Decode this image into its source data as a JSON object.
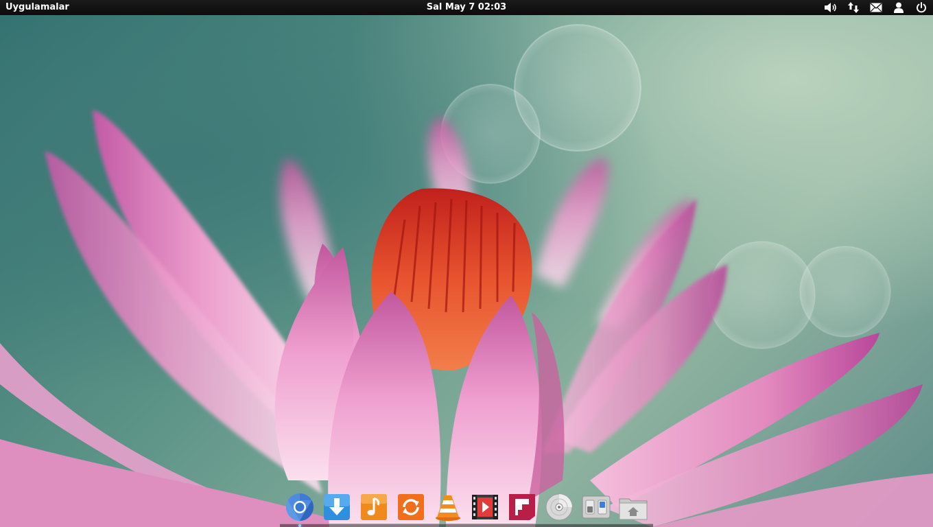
{
  "top_panel": {
    "apps_menu_label": "Uygulamalar",
    "clock_text": "Sal May  7 02:03",
    "indicators": [
      {
        "name": "volume-icon"
      },
      {
        "name": "network-icon"
      },
      {
        "name": "messaging-icon"
      },
      {
        "name": "user-icon"
      },
      {
        "name": "power-icon"
      }
    ]
  },
  "dock": {
    "items": [
      {
        "name": "chromium-browser",
        "icon": "chromium-icon",
        "running": true
      },
      {
        "name": "download-manager",
        "icon": "download-icon",
        "running": false
      },
      {
        "name": "music-player",
        "icon": "music-note-icon",
        "running": false
      },
      {
        "name": "software-update",
        "icon": "refresh-icon",
        "running": false
      },
      {
        "name": "vlc-media-player",
        "icon": "vlc-cone-icon",
        "running": false
      },
      {
        "name": "video-player",
        "icon": "film-strip-icon",
        "running": false
      },
      {
        "name": "flipboard-app",
        "icon": "flipboard-icon",
        "running": false
      },
      {
        "name": "disc-burner",
        "icon": "disc-icon",
        "running": false
      },
      {
        "name": "system-settings",
        "icon": "toggle-switch-icon",
        "running": false
      },
      {
        "name": "home-folder",
        "icon": "home-folder-icon",
        "running": false
      }
    ]
  },
  "colors": {
    "panel_bg": "#111111",
    "panel_text": "#ffffff",
    "wallpaper_teal": "#2e6d6d",
    "petal_pink": "#e59bc7",
    "stamen_red": "#d6352a"
  }
}
